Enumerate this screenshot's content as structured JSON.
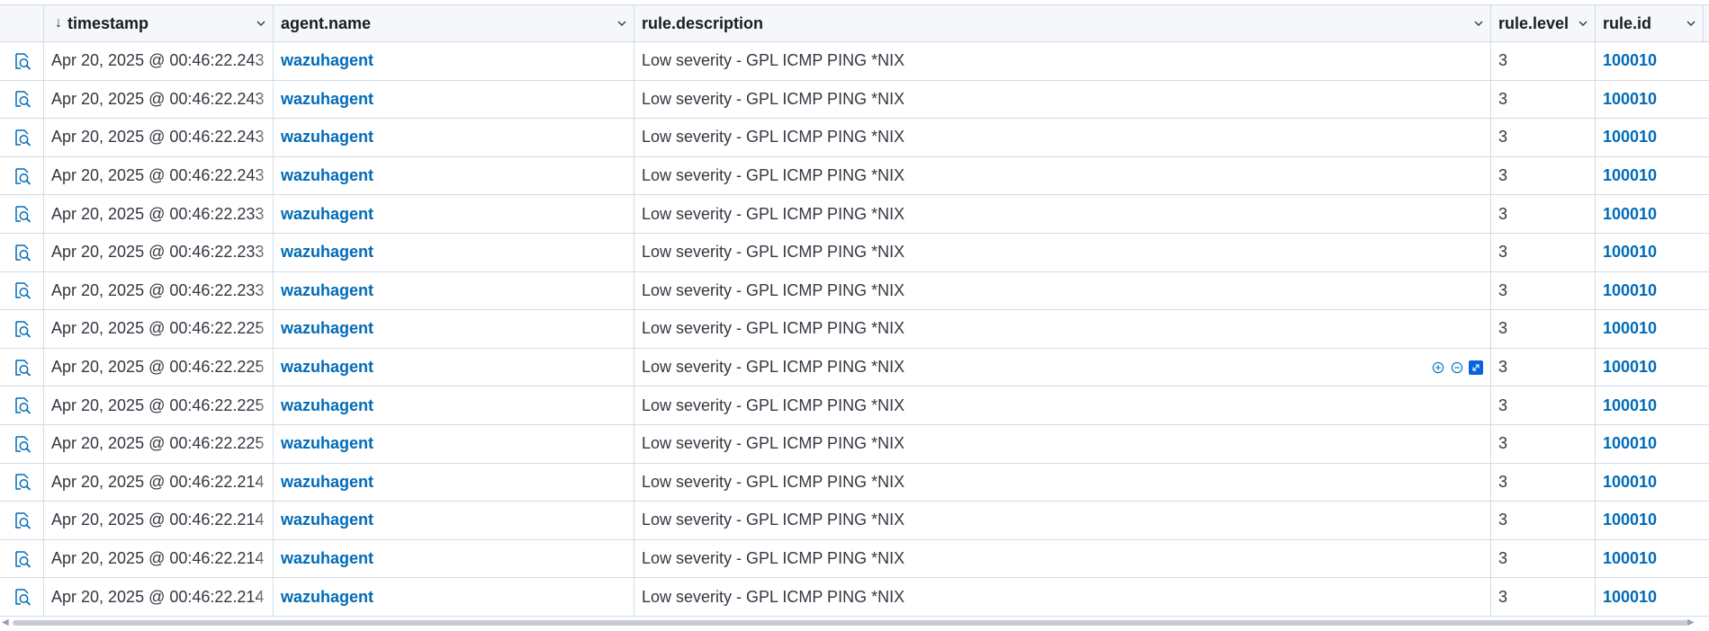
{
  "header": {
    "columns": [
      {
        "label": "timestamp",
        "sort_icon": "↓"
      },
      {
        "label": "agent.name"
      },
      {
        "label": "rule.description"
      },
      {
        "label": "rule.level"
      },
      {
        "label": "rule.id"
      }
    ]
  },
  "rows": [
    {
      "timestamp": "Apr 20, 2025 @ 00:46:22.243",
      "agent": "wazuhagent",
      "description": "Low severity - GPL ICMP PING *NIX",
      "level": "3",
      "rule_id": "100010"
    },
    {
      "timestamp": "Apr 20, 2025 @ 00:46:22.243",
      "agent": "wazuhagent",
      "description": "Low severity - GPL ICMP PING *NIX",
      "level": "3",
      "rule_id": "100010"
    },
    {
      "timestamp": "Apr 20, 2025 @ 00:46:22.243",
      "agent": "wazuhagent",
      "description": "Low severity - GPL ICMP PING *NIX",
      "level": "3",
      "rule_id": "100010"
    },
    {
      "timestamp": "Apr 20, 2025 @ 00:46:22.243",
      "agent": "wazuhagent",
      "description": "Low severity - GPL ICMP PING *NIX",
      "level": "3",
      "rule_id": "100010"
    },
    {
      "timestamp": "Apr 20, 2025 @ 00:46:22.233",
      "agent": "wazuhagent",
      "description": "Low severity - GPL ICMP PING *NIX",
      "level": "3",
      "rule_id": "100010"
    },
    {
      "timestamp": "Apr 20, 2025 @ 00:46:22.233",
      "agent": "wazuhagent",
      "description": "Low severity - GPL ICMP PING *NIX",
      "level": "3",
      "rule_id": "100010"
    },
    {
      "timestamp": "Apr 20, 2025 @ 00:46:22.233",
      "agent": "wazuhagent",
      "description": "Low severity - GPL ICMP PING *NIX",
      "level": "3",
      "rule_id": "100010"
    },
    {
      "timestamp": "Apr 20, 2025 @ 00:46:22.225",
      "agent": "wazuhagent",
      "description": "Low severity - GPL ICMP PING *NIX",
      "level": "3",
      "rule_id": "100010"
    },
    {
      "timestamp": "Apr 20, 2025 @ 00:46:22.225",
      "agent": "wazuhagent",
      "description": "Low severity - GPL ICMP PING *NIX",
      "level": "3",
      "rule_id": "100010"
    },
    {
      "timestamp": "Apr 20, 2025 @ 00:46:22.225",
      "agent": "wazuhagent",
      "description": "Low severity - GPL ICMP PING *NIX",
      "level": "3",
      "rule_id": "100010"
    },
    {
      "timestamp": "Apr 20, 2025 @ 00:46:22.225",
      "agent": "wazuhagent",
      "description": "Low severity - GPL ICMP PING *NIX",
      "level": "3",
      "rule_id": "100010"
    },
    {
      "timestamp": "Apr 20, 2025 @ 00:46:22.214",
      "agent": "wazuhagent",
      "description": "Low severity - GPL ICMP PING *NIX",
      "level": "3",
      "rule_id": "100010"
    },
    {
      "timestamp": "Apr 20, 2025 @ 00:46:22.214",
      "agent": "wazuhagent",
      "description": "Low severity - GPL ICMP PING *NIX",
      "level": "3",
      "rule_id": "100010"
    },
    {
      "timestamp": "Apr 20, 2025 @ 00:46:22.214",
      "agent": "wazuhagent",
      "description": "Low severity - GPL ICMP PING *NIX",
      "level": "3",
      "rule_id": "100010"
    },
    {
      "timestamp": "Apr 20, 2025 @ 00:46:22.214",
      "agent": "wazuhagent",
      "description": "Low severity - GPL ICMP PING *NIX",
      "level": "3",
      "rule_id": "100010"
    }
  ],
  "cell_actions_row": 8,
  "icons": {
    "row_inspect": "inspect-document-icon",
    "sort": "arrow-down-icon",
    "column_menu": "chevron-down-icon",
    "filter_for": "plus-in-circle-icon",
    "filter_out": "minus-in-circle-icon",
    "expand": "expand-icon"
  },
  "colors": {
    "link": "#006bb8",
    "border": "#d3dae6",
    "header_bg": "#f5f7fa",
    "accent": "#0b64dd"
  }
}
